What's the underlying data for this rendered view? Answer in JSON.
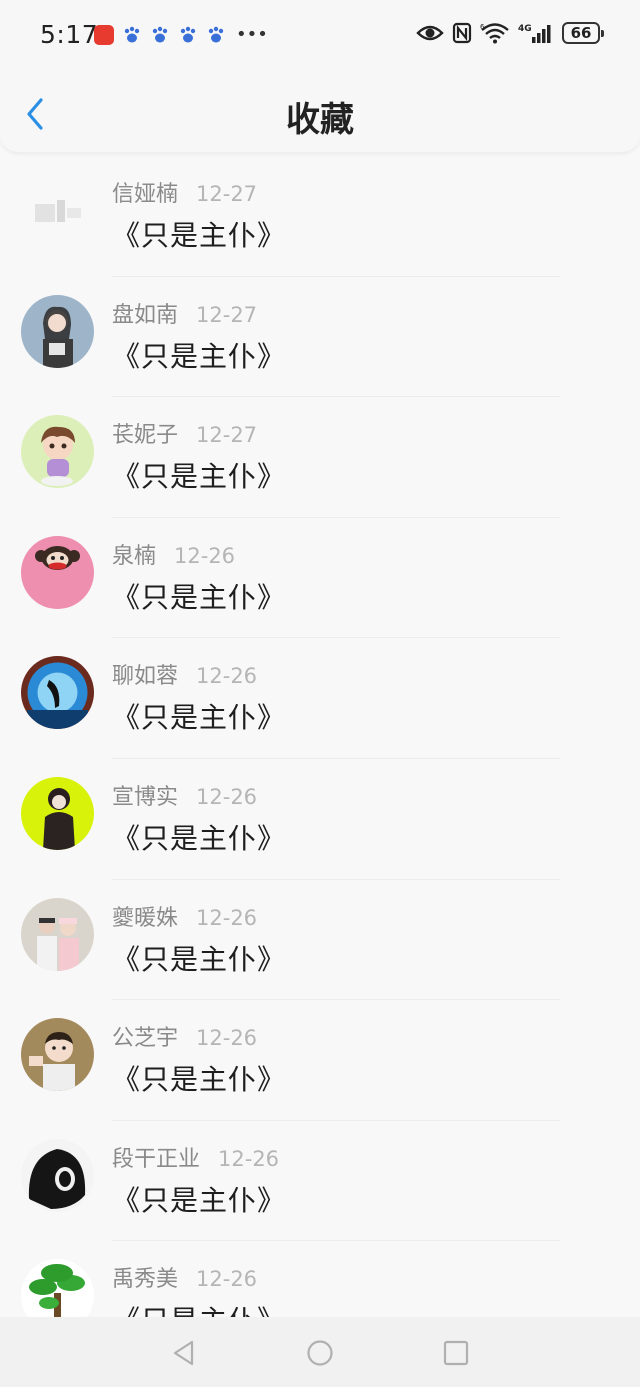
{
  "status_bar": {
    "time": "5:17",
    "battery": "66",
    "network": "4G",
    "sim_slot": "6"
  },
  "header": {
    "title": "收藏"
  },
  "favorites": [
    {
      "name": "信娅楠",
      "date": "12-27",
      "book": "《只是主仆》",
      "avatar": "placeholder-avatar"
    },
    {
      "name": "盘如南",
      "date": "12-27",
      "book": "《只是主仆》",
      "avatar": "girl-avatar"
    },
    {
      "name": "苌妮子",
      "date": "12-27",
      "book": "《只是主仆》",
      "avatar": "cartoon-boy-avatar"
    },
    {
      "name": "泉楠",
      "date": "12-26",
      "book": "《只是主仆》",
      "avatar": "monkey-avatar"
    },
    {
      "name": "聊如蓉",
      "date": "12-26",
      "book": "《只是主仆》",
      "avatar": "orca-avatar"
    },
    {
      "name": "宣博实",
      "date": "12-26",
      "book": "《只是主仆》",
      "avatar": "figure-avatar"
    },
    {
      "name": "夔暖姝",
      "date": "12-26",
      "book": "《只是主仆》",
      "avatar": "couple-avatar"
    },
    {
      "name": "公芝宇",
      "date": "12-26",
      "book": "《只是主仆》",
      "avatar": "child-avatar"
    },
    {
      "name": "段干正业",
      "date": "12-26",
      "book": "《只是主仆》",
      "avatar": "hooded-avatar"
    },
    {
      "name": "禹秀美",
      "date": "12-26",
      "book": "《只是主仆》",
      "avatar": "tree-avatar"
    }
  ]
}
